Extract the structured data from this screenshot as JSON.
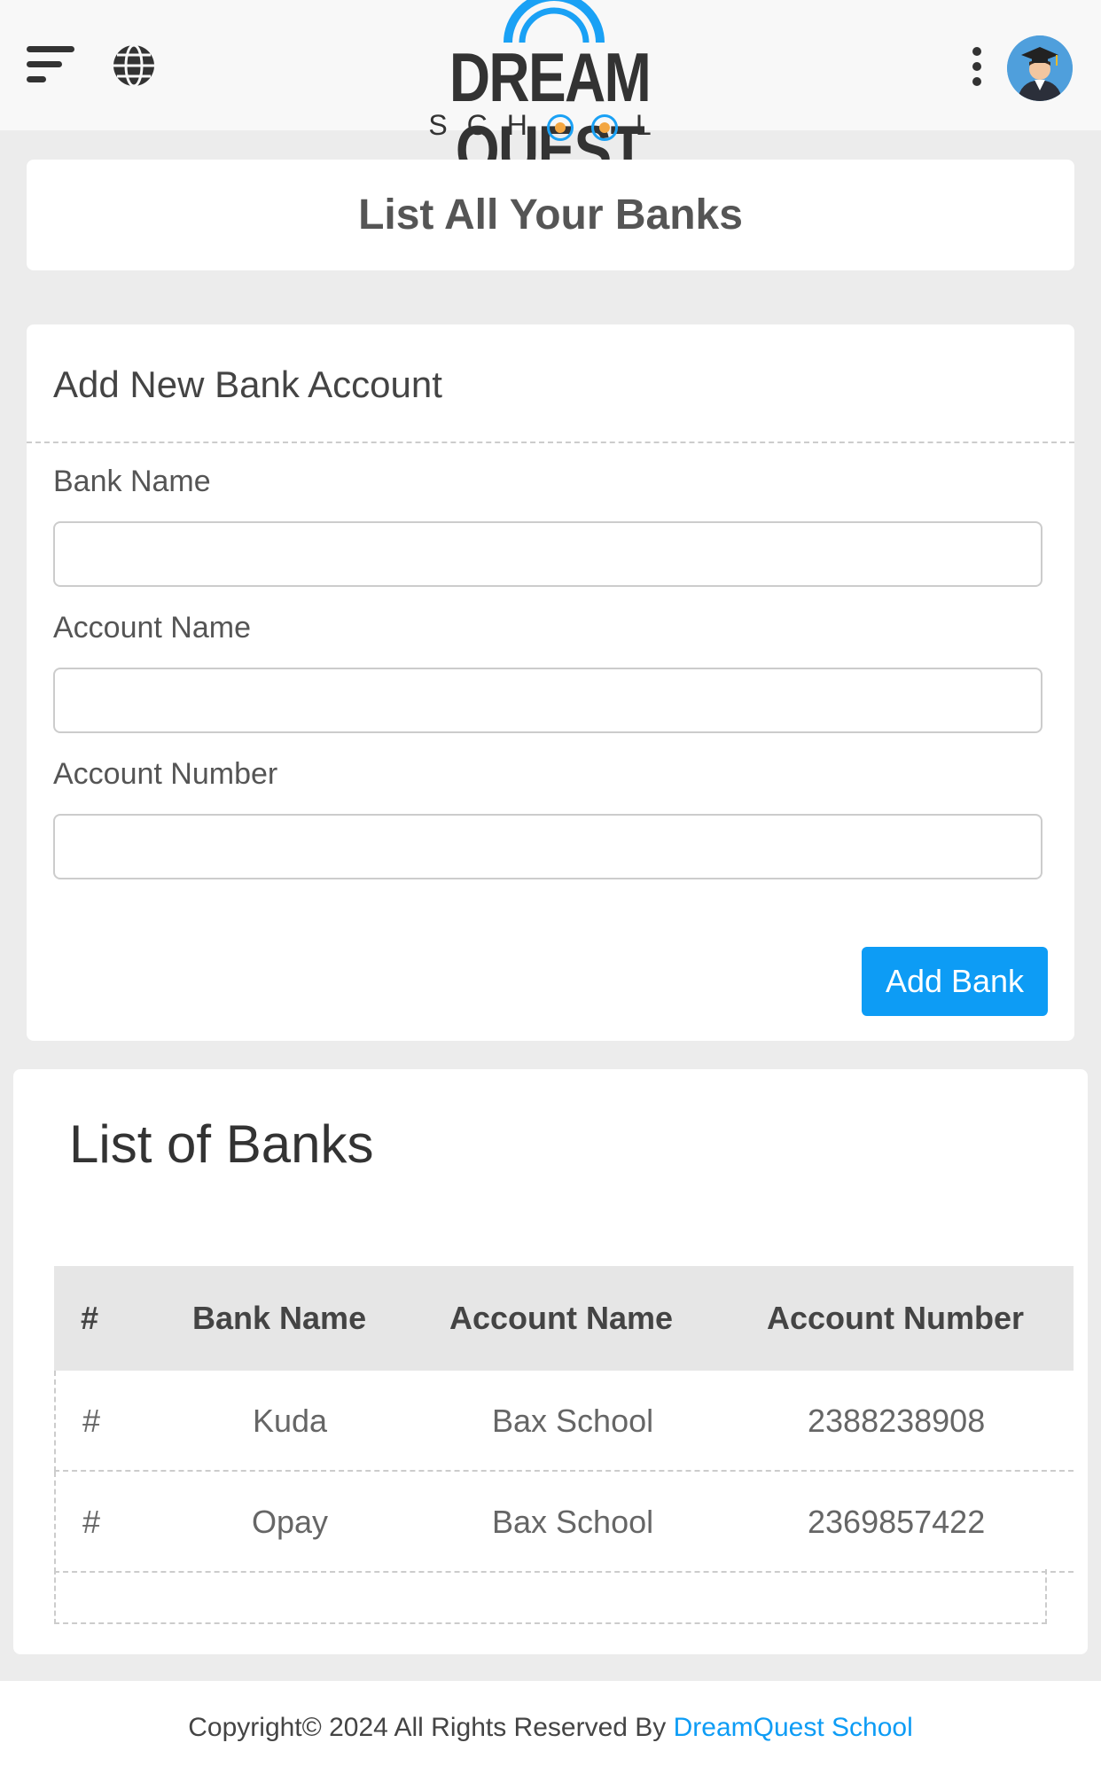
{
  "header": {
    "logo_title": "DREAM QUEST",
    "logo_subtitle": "SCH",
    "logo_subtitle_end": "L",
    "icons": [
      "menu-icon",
      "globe-icon",
      "kebab-icon",
      "avatar"
    ]
  },
  "page": {
    "title": "List All Your Banks"
  },
  "form": {
    "heading": "Add New Bank Account",
    "bank_name_label": "Bank Name",
    "bank_name_value": "",
    "account_name_label": "Account Name",
    "account_name_value": "",
    "account_number_label": "Account Number",
    "account_number_value": "",
    "submit_label": "Add Bank"
  },
  "list": {
    "title": "List of Banks",
    "columns": [
      "#",
      "Bank Name",
      "Account Name",
      "Account Number"
    ],
    "rows": [
      {
        "num": "#",
        "bank": "Kuda",
        "account_name": "Bax School",
        "account_number": "2388238908"
      },
      {
        "num": "#",
        "bank": "Opay",
        "account_name": "Bax School",
        "account_number": "2369857422"
      }
    ]
  },
  "footer": {
    "text": "Copyright© 2024 All Rights Reserved By ",
    "link": "DreamQuest School"
  },
  "colors": {
    "accent": "#0d9cf5",
    "background": "#ececec"
  }
}
